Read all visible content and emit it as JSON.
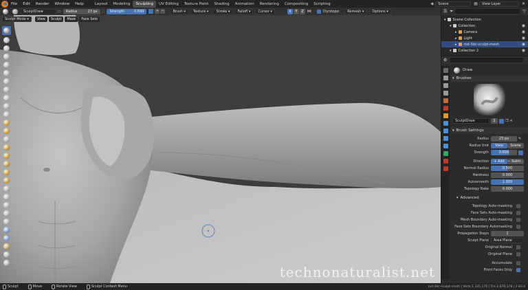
{
  "menubar": {
    "items": [
      "File",
      "Edit",
      "Render",
      "Window",
      "Help"
    ],
    "workspaces": [
      "Layout",
      "Modeling",
      "Sculpting",
      "UV Editing",
      "Texture Paint",
      "Shading",
      "Animation",
      "Rendering",
      "Compositing",
      "Scripting"
    ],
    "active_workspace": "Sculpting",
    "scene": "Scene",
    "view_layer": "View Layer"
  },
  "toolheader": {
    "brush_name": "SculptDraw",
    "radius_label": "Radius",
    "radius_value": "23 px",
    "strength_label": "Strength",
    "strength_value": "0.699",
    "menus": [
      "Brush",
      "Texture",
      "Stroke",
      "Falloff",
      "Cursor"
    ],
    "dyntopo": "Dyntopo",
    "remesh": "Remesh",
    "options": "Options"
  },
  "header": {
    "mode": "Sculpt Mode",
    "menus": [
      "View",
      "Sculpt",
      "Mask",
      "Face Sets"
    ]
  },
  "outliner": {
    "items": [
      {
        "label": "Scene Collection",
        "indent": 0
      },
      {
        "label": "Collection",
        "indent": 1
      },
      {
        "label": "Camera",
        "indent": 2
      },
      {
        "label": "Light",
        "indent": 2
      },
      {
        "label": "rod-3dc-sculpt-mesh",
        "indent": 2,
        "selected": true
      },
      {
        "label": "Collection 2",
        "indent": 1
      }
    ]
  },
  "properties": {
    "tool_name": "Draw",
    "brushes_section": "Brushes",
    "brush_datablock": "SculptDraw",
    "brush_users": "2",
    "brush_settings_section": "Brush Settings",
    "radius_label": "Radius",
    "radius_value": "23 px",
    "radius_unit_label": "Radius Unit",
    "radius_unit_view": "View",
    "radius_unit_scene": "Scene",
    "strength_label": "Strength",
    "strength_value": "0.699",
    "direction_label": "Direction",
    "direction_add": "+ Add",
    "direction_subtract": "− Subtr...",
    "normal_radius_label": "Normal Radius",
    "normal_radius_value": "0.500",
    "hardness_label": "Hardness",
    "hardness_value": "0.000",
    "autosmooth_label": "Autosmooth",
    "autosmooth_value": "1.000",
    "autosmooth_fill": 1.0,
    "topology_rake_label": "Topology Rake",
    "topology_rake_value": "0.000",
    "advanced_section": "Advanced",
    "checks": [
      "Topology Auto-masking",
      "Face Sets Auto-masking",
      "Mesh Boundary Auto-masking",
      "Face Sets Boundary Automasking"
    ],
    "propagation_steps_label": "Propagation Steps",
    "propagation_steps_value": "1",
    "sculpt_plane_label": "Sculpt Plane",
    "sculpt_plane_value": "Area Plane",
    "original_normal": "Original Normal",
    "original_plane": "Original Plane",
    "accumulate": "Accumulate",
    "front_faces_only": "Front Faces Only"
  },
  "statusbar": {
    "items": [
      "Sculpt",
      "Move",
      "Rotate View",
      "Sculpt Context Menu"
    ],
    "stats": "rod-3dc-sculpt-mesh | Verts 1,335,170 | Tris 2,670,178 | 2.83.4"
  },
  "watermark": "technonaturalist.net",
  "colors": {
    "accent": "#4772b3",
    "header": "#2b2b2b",
    "viewport": "#3d3d3d"
  }
}
